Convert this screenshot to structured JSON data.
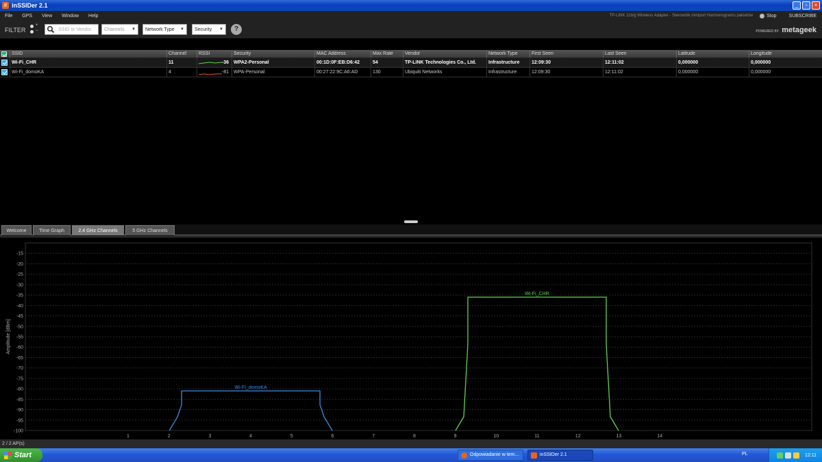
{
  "window": {
    "title": "inSSIDer 2.1",
    "icon_glyph": "#"
  },
  "menu": {
    "items": [
      "File",
      "GPS",
      "View",
      "Window",
      "Help"
    ]
  },
  "adapter_text": "TP-LINK 11b/g Wireless Adapter - Sterownik miniport Harmonogramu pakietów",
  "stop_label": "Stop",
  "subscribe_label": "SUBSCRIBE",
  "toolbar": {
    "filter_label": "FILTER",
    "plus": "+",
    "minus": "−",
    "search_placeholder": "SSID or Vendor",
    "channels_label": "Channels",
    "network_type_label": "Network Type",
    "security_label": "Security",
    "help_glyph": "?"
  },
  "brand": {
    "powered": "POWERED BY",
    "name": "metageek"
  },
  "table": {
    "headers": [
      "SSID",
      "Channel",
      "RSSI",
      "Security",
      "MAC Address",
      "Max Rate",
      "Vendor",
      "Network Type",
      "First Seen",
      "Last Seen",
      "Latitude",
      "Longitude"
    ],
    "rows": [
      {
        "ssid": "Wi-Fi_CHR",
        "channel": "11",
        "rssi": "-36",
        "security": "WPA2-Personal",
        "mac": "00:1D:0F:EB:D6:42",
        "max_rate": "54",
        "vendor": "TP-LINK Technologies Co., Ltd.",
        "network_type": "Infrastructure",
        "first_seen": "12:09:30",
        "last_seen": "12:11:02",
        "latitude": "0,000000",
        "longitude": "0,000000",
        "color": "#5fd64a"
      },
      {
        "ssid": "Wi-Fi_domoKA",
        "channel": "4",
        "rssi": "-81",
        "security": "WPA-Personal",
        "mac": "00:27:22:9C:A6:AD",
        "max_rate": "130",
        "vendor": "Ubiquiti Networks",
        "network_type": "Infrastructure",
        "first_seen": "12:09:30",
        "last_seen": "12:11:02",
        "latitude": "0,000000",
        "longitude": "0,000000",
        "color": "#e05a2a"
      }
    ]
  },
  "tabs": [
    {
      "label": "Welcome",
      "active": false
    },
    {
      "label": "Time Graph",
      "active": false
    },
    {
      "label": "2.4 GHz Channels",
      "active": true
    },
    {
      "label": "5 GHz Channels",
      "active": false
    }
  ],
  "chart_data": {
    "type": "area",
    "xlabel": "",
    "ylabel": "Amplitude [dBm]",
    "ylim": [
      -100,
      -10
    ],
    "yticks": [
      -15,
      -20,
      -25,
      -30,
      -35,
      -40,
      -45,
      -50,
      -55,
      -60,
      -65,
      -70,
      -75,
      -80,
      -85,
      -90,
      -95,
      -100
    ],
    "xticks": [
      1,
      2,
      3,
      4,
      5,
      6,
      7,
      8,
      9,
      10,
      11,
      12,
      13,
      14
    ],
    "grid": true,
    "series": [
      {
        "name": "Wi-Fi_domoKA",
        "channel": 4,
        "amplitude": -81,
        "color": "#3a8fe0"
      },
      {
        "name": "Wi-Fi_CHR",
        "channel": 11,
        "amplitude": -36,
        "color": "#5fd64a"
      }
    ]
  },
  "status": {
    "text": "2 / 2 AP(s)"
  },
  "taskbar": {
    "start_label": "Start",
    "tasks": [
      {
        "label": "Odpowiadanie w tem...",
        "icon_color": "#e8641a"
      },
      {
        "label": "inSSIDer 2.1",
        "icon_color": "#e8641a"
      }
    ],
    "lang": "PL",
    "clock": "12:11"
  }
}
